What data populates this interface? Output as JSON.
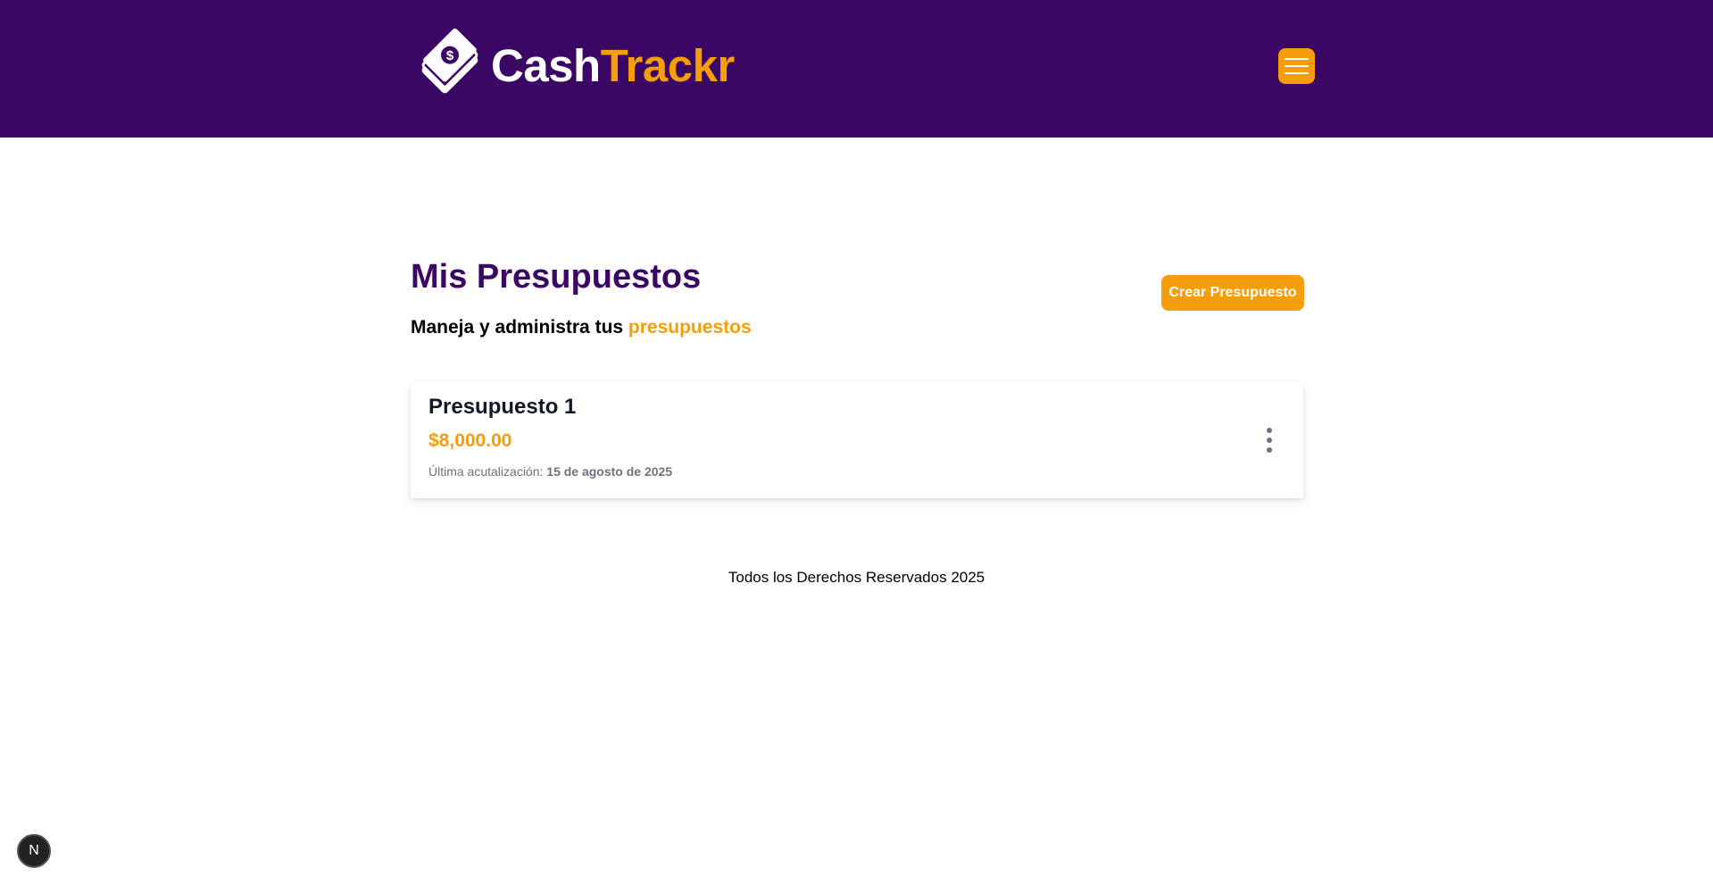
{
  "header": {
    "logo": {
      "text_part1": "Cash",
      "text_part2": "Trackr",
      "icon": "money-bill-icon"
    },
    "menu_icon": "hamburger-menu-icon"
  },
  "main": {
    "title": "Mis Presupuestos",
    "subtitle_prefix": "Maneja y administra tus",
    "subtitle_accent": "presupuestos",
    "create_button_label": "Crear Presupuesto",
    "budgets": [
      {
        "name": "Presupuesto 1",
        "amount": "$8,000.00",
        "updated_label": "Última acutalización:",
        "updated_date": "15 de agosto de 2025",
        "options_icon": "vertical-ellipsis-icon"
      }
    ]
  },
  "footer": {
    "text": "Todos los Derechos Reservados 2025"
  },
  "dev_badge": {
    "label": "N"
  },
  "colors": {
    "brand_purple": "#3b0764",
    "accent_amber": "#f59e0b",
    "text_dark": "#111827",
    "text_muted": "#6b7280"
  }
}
